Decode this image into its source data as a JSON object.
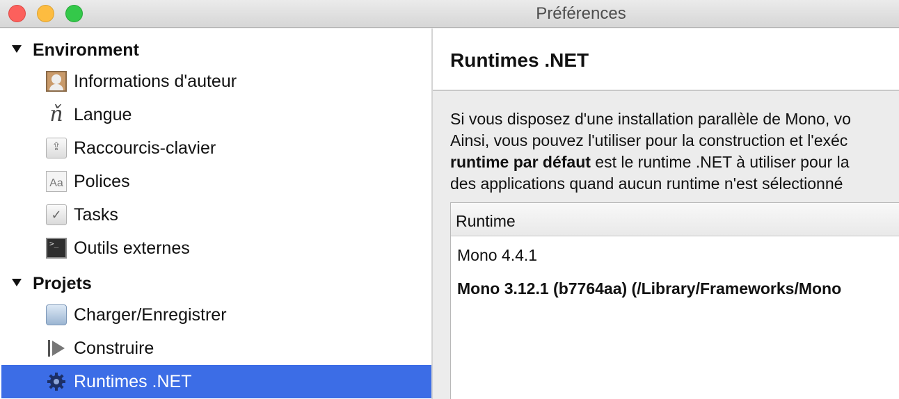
{
  "window": {
    "title": "Préférences"
  },
  "sidebar": {
    "sections": [
      {
        "label": "Environment",
        "items": [
          {
            "label": "Informations d'auteur",
            "icon": "author-icon"
          },
          {
            "label": "Langue",
            "icon": "language-icon"
          },
          {
            "label": "Raccourcis-clavier",
            "icon": "key-bindings-icon"
          },
          {
            "label": "Polices",
            "icon": "fonts-icon"
          },
          {
            "label": "Tasks",
            "icon": "tasks-icon"
          },
          {
            "label": "Outils externes",
            "icon": "terminal-icon"
          }
        ]
      },
      {
        "label": "Projets",
        "items": [
          {
            "label": "Charger/Enregistrer",
            "icon": "disk-icon"
          },
          {
            "label": "Construire",
            "icon": "build-icon"
          },
          {
            "label": "Runtimes .NET",
            "icon": "gear-icon",
            "selected": true
          }
        ]
      }
    ]
  },
  "main": {
    "title": "Runtimes .NET",
    "description": {
      "line1": "Si vous disposez d'une installation parallèle de Mono, vo",
      "line2": "Ainsi, vous pouvez l'utiliser pour la construction et l'exéc",
      "line3_bold": "runtime par défaut",
      "line3_rest": " est le runtime .NET à utiliser pour la",
      "line4": "des applications quand aucun runtime n'est sélectionné"
    },
    "table": {
      "column": "Runtime",
      "rows": [
        {
          "label": "Mono 4.4.1",
          "default": false
        },
        {
          "label": "Mono 3.12.1 (b7764aa) (/Library/Frameworks/Mono",
          "default": true
        }
      ]
    }
  },
  "colors": {
    "selection": "#3c6de6",
    "close": "#fc605c",
    "minimize": "#fdbc40",
    "maximize": "#34c84a"
  }
}
